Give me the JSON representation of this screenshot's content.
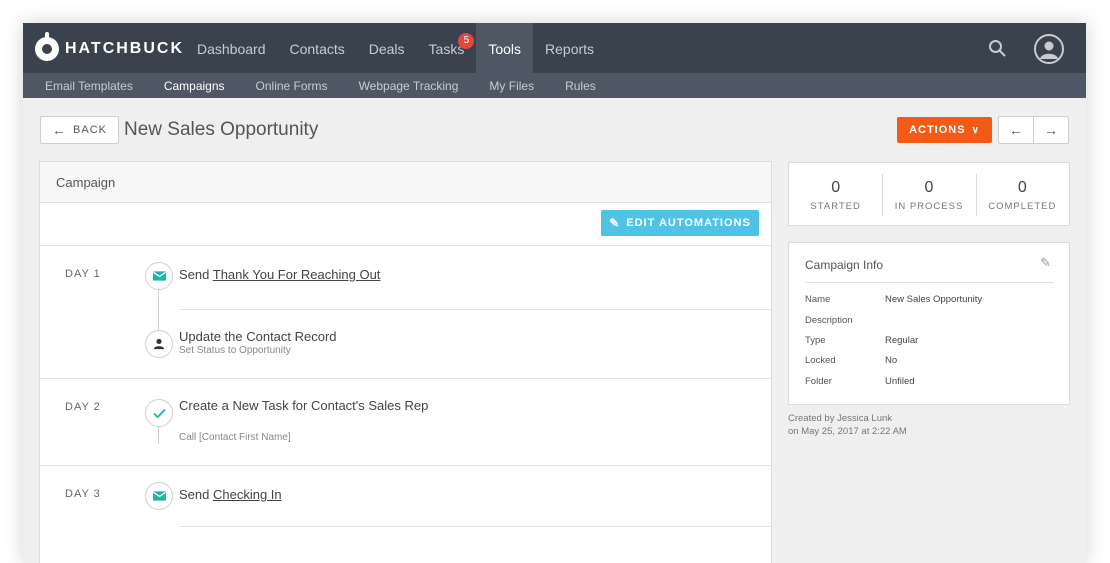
{
  "brand": {
    "name": "HATCHBUCK"
  },
  "nav": {
    "items": [
      {
        "label": "Dashboard"
      },
      {
        "label": "Contacts"
      },
      {
        "label": "Deals"
      },
      {
        "label": "Tasks",
        "badge": "5"
      },
      {
        "label": "Tools",
        "active": true
      },
      {
        "label": "Reports"
      }
    ]
  },
  "subnav": {
    "items": [
      {
        "label": "Email Templates"
      },
      {
        "label": "Campaigns",
        "active": true
      },
      {
        "label": "Online Forms"
      },
      {
        "label": "Webpage Tracking"
      },
      {
        "label": "My Files"
      },
      {
        "label": "Rules"
      }
    ]
  },
  "header": {
    "back_label": "BACK",
    "title": "New Sales Opportunity",
    "actions_label": "ACTIONS"
  },
  "campaign": {
    "panel_title": "Campaign",
    "edit_label": "EDIT AUTOMATIONS",
    "days": [
      {
        "label": "DAY 1"
      },
      {
        "label": "DAY 2"
      },
      {
        "label": "DAY 3"
      }
    ],
    "steps": [
      {
        "prefix": "Send ",
        "link": "Thank You For Reaching Out",
        "icon": "email-icon"
      },
      {
        "title": "Update the Contact Record",
        "sub": "Set Status to Opportunity",
        "icon": "person-icon"
      },
      {
        "title": "Create a New Task for Contact's Sales Rep",
        "sub": "Call [Contact First Name]",
        "icon": "check-icon"
      },
      {
        "prefix": "Send ",
        "link": "Checking In",
        "icon": "email-icon"
      }
    ]
  },
  "stats": [
    {
      "value": "0",
      "label": "STARTED"
    },
    {
      "value": "0",
      "label": "IN PROCESS"
    },
    {
      "value": "0",
      "label": "COMPLETED"
    }
  ],
  "info": {
    "title": "Campaign Info",
    "rows": [
      {
        "key": "Name",
        "value": "New Sales Opportunity"
      },
      {
        "key": "Description",
        "value": ""
      },
      {
        "key": "Type",
        "value": "Regular"
      },
      {
        "key": "Locked",
        "value": "No"
      },
      {
        "key": "Folder",
        "value": "Unfiled"
      }
    ],
    "created_by": "Created by Jessica Lunk",
    "created_on": "on May 25, 2017 at 2:22 AM"
  },
  "colors": {
    "nav_bg": "#3a424d",
    "subnav_bg": "#4e5763",
    "actions": "#f25a16",
    "edit_automations": "#4fc3e6",
    "step_icon": "#1fb5a6",
    "badge": "#e8453c"
  }
}
